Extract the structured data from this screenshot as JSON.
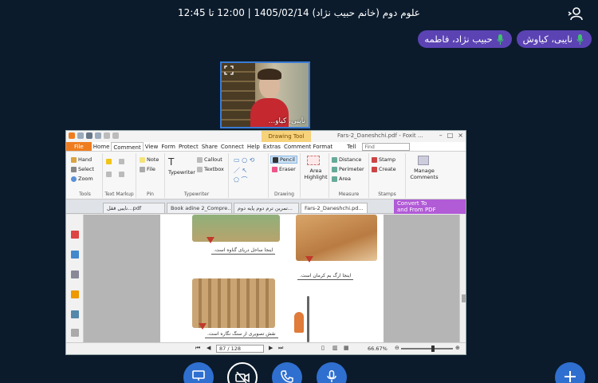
{
  "header": {
    "meeting_title": "علوم دوم (خانم حبیب نژاد) 1405/02/14 | 12:00 تا 12:45"
  },
  "participants": [
    {
      "name": "نایبی، کیاوش",
      "mic": "on"
    },
    {
      "name": "حبیب نژاد، فاطمه",
      "mic": "on"
    }
  ],
  "video_thumb": {
    "label": "نایبی، کیاو..."
  },
  "app": {
    "drawing_tool": "Drawing Tool",
    "file_title": "Fars-2_Daneshchi.pdf - Foxit ...",
    "menu": [
      "File",
      "Home",
      "Comment",
      "View",
      "Form",
      "Protect",
      "Share",
      "Connect",
      "Help",
      "Extras",
      "Comment Format"
    ],
    "tell": "Tell",
    "search_placeholder": "Find",
    "ribbon": {
      "tools": {
        "items": [
          "Hand",
          "Select",
          "Zoom"
        ],
        "caption": "Tools"
      },
      "text_markup": {
        "caption": "Text Markup"
      },
      "pin": {
        "items": [
          "Note",
          "File"
        ],
        "caption": "Pin"
      },
      "typewriter": {
        "items": [
          "Typewriter",
          "Callout",
          "Textbox"
        ],
        "caption": "Typewriter"
      },
      "drawing": {
        "items": [
          "Pencil",
          "Eraser"
        ],
        "caption": "Drawing"
      },
      "area_highlight": "Area Highlight",
      "measure": {
        "items": [
          "Distance",
          "Perimeter",
          "Area"
        ],
        "caption": "Measure"
      },
      "stamps": {
        "items": [
          "Stamp",
          "Create"
        ],
        "caption": "Stamps"
      },
      "manage": "Manage Comments"
    },
    "tabs": [
      "نایبی ققل...pdf",
      "Book adine 2_Compre...",
      "تمرین ترم دوم پایه دوم...",
      "Fars-2_Daneshchi.pd..."
    ],
    "convert": {
      "line1": "Convert To",
      "line2": "and From PDF"
    },
    "captions": [
      "اینجا ساحل دریای گناوه است.",
      "اینجا ارگ بم کرمان است.",
      "نقش تصویری از سنگ نگاره است."
    ],
    "status": {
      "page": "87 / 128",
      "zoom": "66.67%"
    }
  }
}
